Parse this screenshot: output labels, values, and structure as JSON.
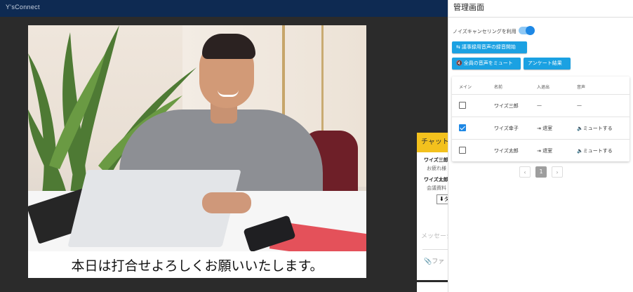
{
  "app": {
    "title": "Y'sConnect"
  },
  "video": {
    "caption": "本日は打合せよろしくお願いいたします。"
  },
  "chat": {
    "header": "チャット",
    "messages": [
      {
        "name": "ワイズ三郎",
        "text": "お疲れ様"
      },
      {
        "name": "ワイズ太郎",
        "text": "会議資料"
      }
    ],
    "download_label": "ダ",
    "input_placeholder": "メッセージ",
    "file_label": "ファ"
  },
  "admin": {
    "title": "管理画面",
    "noise_cancel_label": "ノイズキャンセリングを利用",
    "noise_cancel_on": true,
    "buttons": {
      "record": "議事録用音声の録音開始",
      "mute_all": "全員の音声をミュート",
      "survey": "アンケート結果"
    },
    "table": {
      "headers": [
        "メイン",
        "名前",
        "入退出",
        "音声"
      ],
      "rows": [
        {
          "main": false,
          "name": "ワイズ三郎",
          "exit": "—",
          "audio": "—"
        },
        {
          "main": true,
          "name": "ワイズ幸子",
          "exit": "退室",
          "audio": "ミュートする"
        },
        {
          "main": false,
          "name": "ワイズ太郎",
          "exit": "退室",
          "audio": "ミュートする"
        }
      ]
    },
    "pagination": {
      "prev": "‹",
      "current": "1",
      "next": "›"
    }
  },
  "colors": {
    "topbar": "#0e2a52",
    "accent": "#1ba1e2",
    "chat_header": "#f3c11d"
  }
}
